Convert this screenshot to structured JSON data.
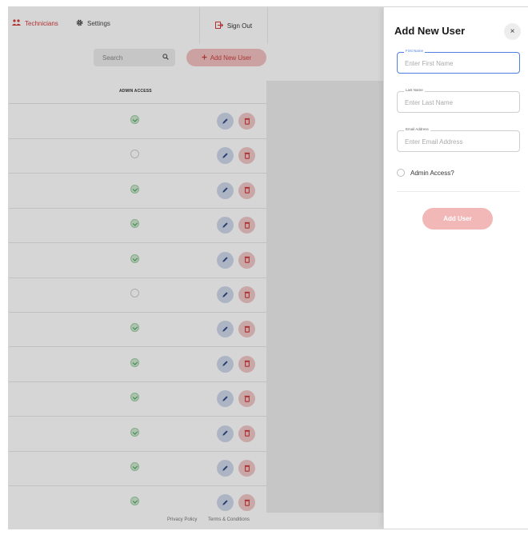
{
  "topnav": {
    "technicians_label": "Technicians",
    "settings_label": "Settings",
    "signout_label": "Sign Out"
  },
  "toolbar": {
    "search_placeholder": "Search",
    "add_user_label": "Add New User"
  },
  "table": {
    "admin_header": "ADMIN ACCESS",
    "rows": [
      {
        "admin": true
      },
      {
        "admin": false
      },
      {
        "admin": true
      },
      {
        "admin": true
      },
      {
        "admin": true
      },
      {
        "admin": false
      },
      {
        "admin": true
      },
      {
        "admin": true
      },
      {
        "admin": true
      },
      {
        "admin": true
      },
      {
        "admin": true
      },
      {
        "admin": true
      }
    ]
  },
  "footer": {
    "privacy_label": "Privacy Policy",
    "terms_label": "Terms & Conditions"
  },
  "panel": {
    "title": "Add New User",
    "close_label": "×",
    "fields": [
      {
        "label": "First Name",
        "placeholder": "Enter First Name"
      },
      {
        "label": "Last Name",
        "placeholder": "Enter Last Name"
      },
      {
        "label": "Email Address",
        "placeholder": "Enter Email Address"
      }
    ],
    "admin_access_label": "Admin Access?",
    "submit_label": "Add User"
  },
  "colors": {
    "accent_red": "#d33a3a",
    "focus_blue": "#4f7fe0",
    "check_green": "#3e9a4c"
  },
  "icons": {
    "technicians": "users-icon",
    "settings": "gear-icon",
    "signout": "sign-out-icon",
    "search": "search-icon",
    "add": "plus-icon",
    "edit": "pencil-icon",
    "delete": "trash-icon",
    "admin_on": "check-circle-icon",
    "admin_off": "empty-circle-icon"
  }
}
